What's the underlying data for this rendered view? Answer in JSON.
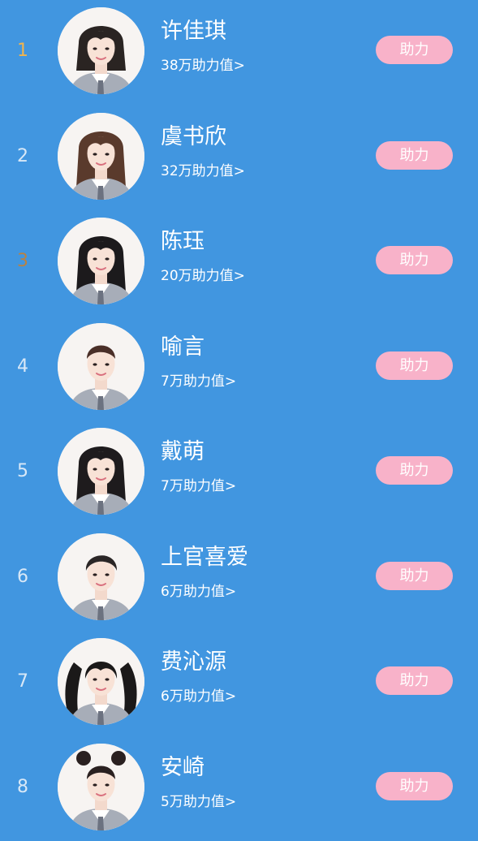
{
  "ranking": [
    {
      "rank": "1",
      "name": "许佳琪",
      "value": "38万助力值>",
      "button_label": "助力",
      "rank_color": "#f0b44e",
      "hair": "#2a2422",
      "hair_style": "bob"
    },
    {
      "rank": "2",
      "name": "虞书欣",
      "value": "32万助力值>",
      "button_label": "助力",
      "rank_color": "#d8e8f7",
      "hair": "#5a3a2c",
      "hair_style": "long"
    },
    {
      "rank": "3",
      "name": "陈珏",
      "value": "20万助力值>",
      "button_label": "助力",
      "rank_color": "#b88244",
      "hair": "#1c1a1c",
      "hair_style": "long"
    },
    {
      "rank": "4",
      "name": "喻言",
      "value": "7万助力值>",
      "button_label": "助力",
      "rank_color": "#d8e8f7",
      "hair": "#4a2f28",
      "hair_style": "tied"
    },
    {
      "rank": "5",
      "name": "戴萌",
      "value": "7万助力值>",
      "button_label": "助力",
      "rank_color": "#d8e8f7",
      "hair": "#1e1b1d",
      "hair_style": "long"
    },
    {
      "rank": "6",
      "name": "上官喜爱",
      "value": "6万助力值>",
      "button_label": "助力",
      "rank_color": "#d8e8f7",
      "hair": "#2b2626",
      "hair_style": "short"
    },
    {
      "rank": "7",
      "name": "费沁源",
      "value": "6万助力值>",
      "button_label": "助力",
      "rank_color": "#d8e8f7",
      "hair": "#1b1919",
      "hair_style": "twintails"
    },
    {
      "rank": "8",
      "name": "安崎",
      "value": "5万助力值>",
      "button_label": "助力",
      "rank_color": "#d8e8f7",
      "hair": "#2a2020",
      "hair_style": "buns"
    }
  ],
  "colors": {
    "background": "#4196e0",
    "button": "#f8b2c9",
    "text": "#ffffff"
  },
  "icons": {
    "avatar": "member-portrait-icon"
  }
}
